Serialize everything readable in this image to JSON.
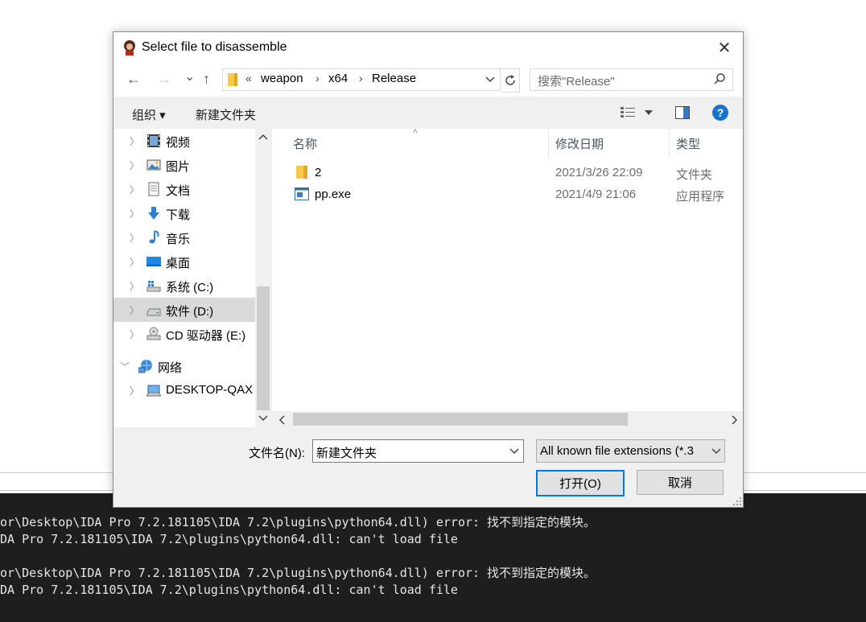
{
  "dialog": {
    "title": "Select file to disassemble",
    "close_label": "✕"
  },
  "nav": {
    "back": "←",
    "forward": "→",
    "recent": "⌄",
    "up": "↑",
    "breadcrumb_overflow": "«",
    "breadcrumbs": [
      "weapon",
      "x64",
      "Release"
    ],
    "search_placeholder": "搜索\"Release\""
  },
  "toolbar": {
    "organize": "组织 ▾",
    "new_folder": "新建文件夹",
    "help": "?"
  },
  "sidebar": {
    "items": [
      {
        "label": "视频",
        "icon": "video-icon"
      },
      {
        "label": "图片",
        "icon": "pictures-icon"
      },
      {
        "label": "文档",
        "icon": "document-icon"
      },
      {
        "label": "下载",
        "icon": "download-icon"
      },
      {
        "label": "音乐",
        "icon": "music-icon"
      },
      {
        "label": "桌面",
        "icon": "desktop-icon"
      },
      {
        "label": "系统 (C:)",
        "icon": "system-drive-icon"
      },
      {
        "label": "软件 (D:)",
        "icon": "drive-icon",
        "selected": true
      },
      {
        "label": "CD 驱动器 (E:)",
        "icon": "cd-drive-icon"
      },
      {
        "label": "网络",
        "icon": "network-icon",
        "expanded": true
      },
      {
        "label": "DESKTOP-QAX",
        "icon": "computer-icon"
      }
    ]
  },
  "filelist": {
    "columns": [
      "名称",
      "修改日期",
      "类型"
    ],
    "rows": [
      {
        "name": "2",
        "date": "2021/3/26 22:09",
        "type": "文件夹",
        "icon": "folder-icon"
      },
      {
        "name": "pp.exe",
        "date": "2021/4/9 21:06",
        "type": "应用程序",
        "icon": "exe-icon"
      }
    ]
  },
  "footer": {
    "filename_label": "文件名(N):",
    "filename_value": "新建文件夹",
    "filetype_value": "All known file extensions (*.3",
    "open_label": "打开(O)",
    "cancel_label": "取消"
  },
  "console": {
    "lines": [
      "or\\Desktop\\IDA Pro 7.2.181105\\IDA 7.2\\plugins\\python64.dll) error: 找不到指定的模块。",
      "DA Pro 7.2.181105\\IDA 7.2\\plugins\\python64.dll: can't load file",
      "or\\Desktop\\IDA Pro 7.2.181105\\IDA 7.2\\plugins\\python64.dll) error: 找不到指定的模块。",
      "DA Pro 7.2.181105\\IDA 7.2\\plugins\\python64.dll: can't load file"
    ]
  },
  "colors": {
    "accent": "#0078d7",
    "selection": "#d9d9d9",
    "console_bg": "#1e1e1e"
  }
}
